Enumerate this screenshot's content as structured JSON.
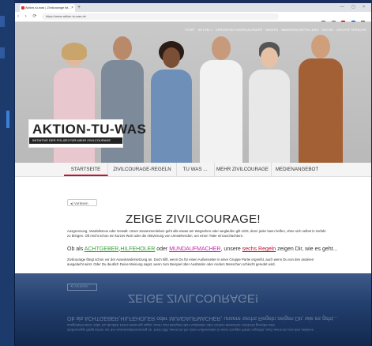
{
  "browser": {
    "tab_title": "Aktion-tu-was | Zivilcourage ist...",
    "url": "https://www.aktion-tu-was.de",
    "newtab": "+",
    "close": "×",
    "nav_glyphs": "‹ › ⟳ ⌂",
    "window_controls": "— ▢ ×"
  },
  "hero": {
    "topnav": "START · AKTUELL · VERANSTALTUNGSKALENDER · MEDIEN · WANDERAUSSTELLUNG · SUCHE · LEICHTE SPRACHE",
    "logo_title": "AKTION-TU-WAS",
    "logo_sub": "INITIATIVE DER POLIZEI FÜR MEHR ZIVILCOURAGE"
  },
  "menu": {
    "items": [
      "STARTSEITE",
      "ZIVILCOURAGE-REGELN",
      "TU WAS ...",
      "MEHR ZIVILCOURAGE",
      "MEDIENANGEBOT"
    ]
  },
  "content": {
    "vorlesen": "◂) Vorlesen",
    "title": "ZEIGE ZIVILCOURAGE!",
    "p1": "Ausgrenzung, Vandalismus oder Gewalt: Unser Zusammenleben geht alle etwas an! Wegsehen oder weglaufen gilt nicht, denn jeder kann helfen, ohne sich selbst in Gefahr zu bringen. Oft reicht schon ein kurzes Wort oder die Aktivierung von Umstehenden, um einen Täter einzuschüchtern.",
    "hl_pre": "Ob als ",
    "hl_a": "ACHTGEBER",
    "hl_b": "HILFEHOLER",
    "hl_mid": " oder ",
    "hl_c": "MUNDAUFMACHER",
    "hl_post": ", unsere ",
    "hl_d": "sechs Regeln",
    "hl_end": " zeigen Dir, wie es geht...",
    "p2": "Zivilcourage fängt schon vor der Auseinandersetzung an. Doch hilft, wenn Du für einen Außenseiter in einer Gruppe Partei ergreifst, auch wenn Du von den anderen ausgelacht wirst. Oder Du deutlich Deine Meinung sagst, wenn zum Beispiel über Ausländer oder Anders Menschen schlecht geredet wird."
  },
  "colors": {
    "accent_red": "#c8102e",
    "green": "#3a9c3a",
    "magenta": "#c026a6"
  }
}
